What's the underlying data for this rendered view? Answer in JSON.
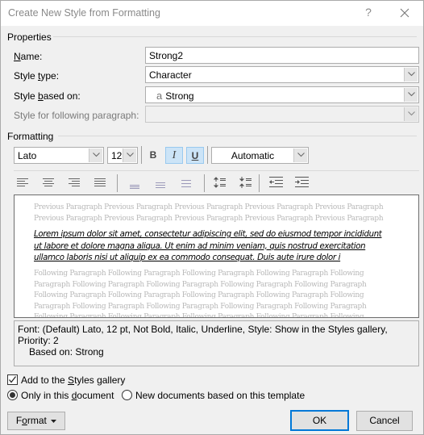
{
  "window": {
    "title": "Create New Style from Formatting",
    "help_label": "?",
    "close_label": "close"
  },
  "properties": {
    "section_label": "Properties",
    "name": {
      "label_pre": "",
      "label_u": "N",
      "label_post": "ame:",
      "value": "Strong2"
    },
    "style_type": {
      "label_pre": "Style ",
      "label_u": "t",
      "label_post": "ype:",
      "value": "Character"
    },
    "style_based_on": {
      "label_pre": "Style ",
      "label_u": "b",
      "label_post": "ased on:",
      "value_icon": "a",
      "value": "Strong"
    },
    "style_following": {
      "label": "Style for following paragraph:",
      "value": ""
    }
  },
  "formatting": {
    "section_label": "Formatting",
    "font": "Lato",
    "size": "12",
    "bold_label": "B",
    "italic_label": "I",
    "underline_label": "U",
    "bold_active": false,
    "italic_active": true,
    "underline_active": true,
    "color": "Automatic",
    "accent_color": "#cce4f7"
  },
  "preview": {
    "previous_paragraph": "Previous Paragraph Previous Paragraph Previous Paragraph Previous Paragraph Previous Paragraph Previous Paragraph Previous Paragraph Previous Paragraph Previous Paragraph Previous Paragraph",
    "sample_text": "Lorem ipsum dolor sit amet, consectetur adipiscing elit, sed do eiusmod tempor incididunt ut labore et dolore magna aliqua. Ut enim ad minim veniam, quis nostrud exercitation ullamco laboris nisi ut aliquip ex ea commodo consequat. Duis aute irure dolor i",
    "following_paragraph": "Following Paragraph Following Paragraph Following Paragraph Following Paragraph Following Paragraph Following Paragraph Following Paragraph Following Paragraph Following Paragraph Following Paragraph Following Paragraph Following Paragraph Following Paragraph Following Paragraph Following Paragraph Following Paragraph Following Paragraph Following Paragraph Following Paragraph Following Paragraph Following Paragraph Following Paragraph Following Paragraph Following Paragraph Following Paragraph"
  },
  "description": {
    "line1": "Font: (Default) Lato, 12 pt, Not Bold, Italic, Underline, Style: Show in the Styles gallery, Priority: 2",
    "line2": "Based on: Strong"
  },
  "options": {
    "add_to_gallery": {
      "label_pre": "Add to the ",
      "label_u": "S",
      "label_post": "tyles gallery",
      "checked": true
    },
    "only_in_document": {
      "label_pre": "Only in this ",
      "label_u": "d",
      "label_post": "ocument",
      "selected": true
    },
    "new_documents": {
      "label": "New documents based on this template",
      "selected": false
    }
  },
  "buttons": {
    "format_pre": "F",
    "format_u": "o",
    "format_post": "rmat",
    "ok": "OK",
    "cancel": "Cancel"
  }
}
